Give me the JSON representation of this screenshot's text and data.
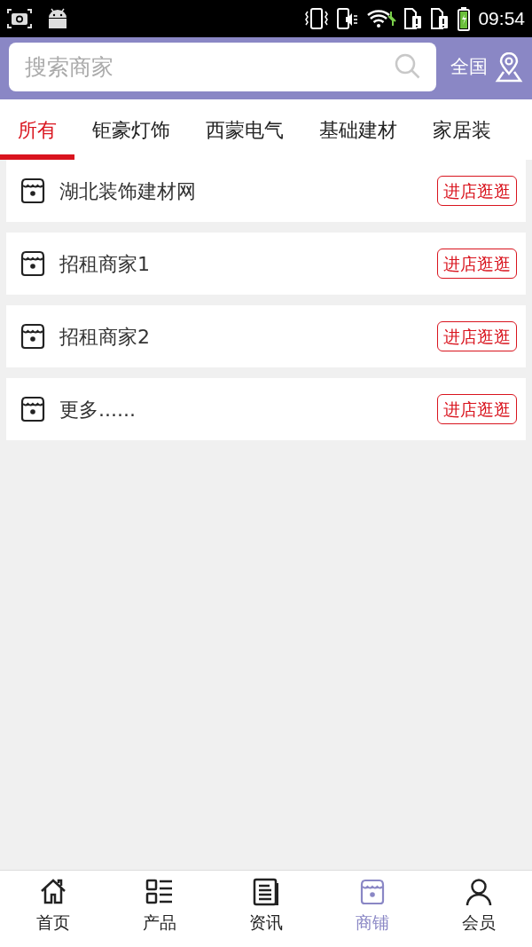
{
  "status_bar": {
    "time": "09:54"
  },
  "search": {
    "placeholder": "搜索商家"
  },
  "region": "全国",
  "tabs": [
    {
      "label": "所有",
      "selected": true
    },
    {
      "label": "钜豪灯饰",
      "selected": false
    },
    {
      "label": "西蒙电气",
      "selected": false
    },
    {
      "label": "基础建材",
      "selected": false
    },
    {
      "label": "家居装",
      "selected": false
    }
  ],
  "shops": [
    {
      "name": "湖北装饰建材网",
      "button": "进店逛逛"
    },
    {
      "name": "招租商家1",
      "button": "进店逛逛"
    },
    {
      "name": "招租商家2",
      "button": "进店逛逛"
    },
    {
      "name": "更多......",
      "button": "进店逛逛"
    }
  ],
  "bottom_nav": [
    {
      "label": "首页",
      "kind": "home",
      "selected": false
    },
    {
      "label": "产品",
      "kind": "products",
      "selected": false
    },
    {
      "label": "资讯",
      "kind": "news",
      "selected": false
    },
    {
      "label": "商铺",
      "kind": "shops",
      "selected": true
    },
    {
      "label": "会员",
      "kind": "member",
      "selected": false
    }
  ]
}
